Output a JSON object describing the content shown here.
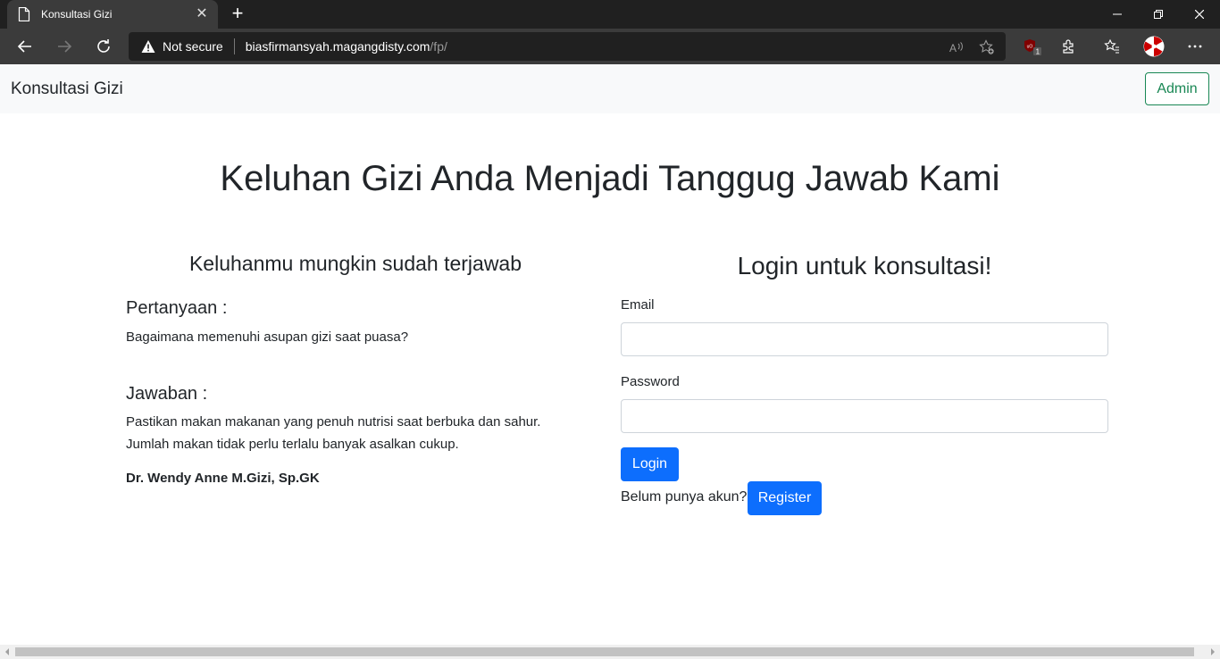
{
  "browser": {
    "tab_title": "Konsultasi Gizi",
    "security_label": "Not secure",
    "url_host": "biasfirmansyah.magangdisty.com",
    "url_path": "/fp/",
    "extension_badge": "1"
  },
  "navbar": {
    "brand": "Konsultasi Gizi",
    "admin_label": "Admin"
  },
  "headline": "Keluhan Gizi Anda Menjadi Tanggug Jawab Kami",
  "faq": {
    "title": "Keluhanmu mungkin sudah terjawab",
    "question_label": "Pertanyaan :",
    "question": "Bagaimana memenuhi asupan gizi saat puasa?",
    "answer_label": "Jawaban :",
    "answer_line1": "Pastikan makan makanan yang penuh nutrisi saat berbuka dan sahur.",
    "answer_line2": "Jumlah makan tidak perlu terlalu banyak asalkan cukup.",
    "doctor": "Dr. Wendy Anne M.Gizi, Sp.GK"
  },
  "login": {
    "title": "Login untuk konsultasi!",
    "email_label": "Email",
    "email_value": "",
    "password_label": "Password",
    "password_value": "",
    "login_label": "Login",
    "no_account_text": "Belum punya akun?",
    "register_label": "Register"
  },
  "colors": {
    "primary": "#0d6efd",
    "success": "#198754",
    "navbar_bg": "#f8f9fa"
  }
}
